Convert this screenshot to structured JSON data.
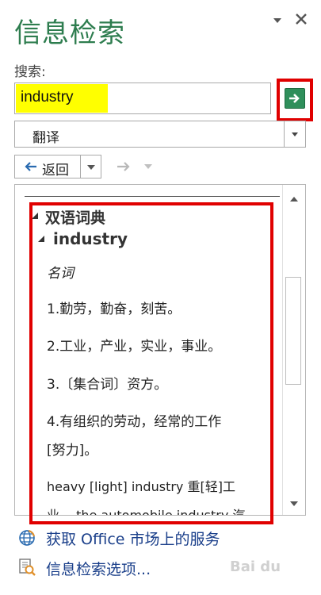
{
  "pane": {
    "title": "信息检索"
  },
  "search": {
    "label": "搜索:",
    "value": "industry"
  },
  "source": {
    "selected": "翻译"
  },
  "nav": {
    "back_label": "返回"
  },
  "results": {
    "section_title": "双语词典",
    "entry_word": "industry",
    "part_of_speech": "名词",
    "definitions": [
      "1.勤劳，勤奋，刻苦。",
      "2.工业，产业，实业，事业。",
      "3.〔集合词〕资方。",
      "4.有组织的劳动，经常的工作",
      "[努力]。",
      "heavy [light] industry 重[轻]工",
      "业。 the automobile industry 汽"
    ]
  },
  "footer": {
    "market_link": "获取 Office 市场上的服务",
    "options_link": "信息检索选项..."
  },
  "watermark": "Bai du",
  "colors": {
    "title": "#2e7d4f",
    "highlight": "#ffff00",
    "annotation_border": "#e00000",
    "go_button": "#2f8f5b",
    "link": "#1a3f8a"
  }
}
